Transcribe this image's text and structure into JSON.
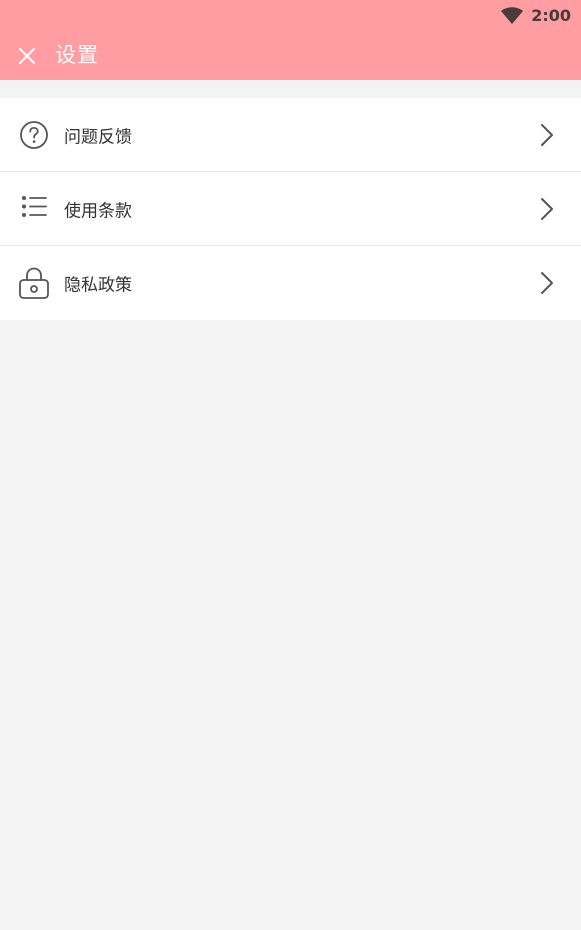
{
  "status_bar": {
    "time": "2:00",
    "wifi_icon": "wifi-icon"
  },
  "app_bar": {
    "close_icon": "close-icon",
    "title": "设置",
    "background_color": "#ff9da2"
  },
  "settings": {
    "items": [
      {
        "label": "问题反馈",
        "icon": "help-circle-icon",
        "chevron": "chevron-right-icon"
      },
      {
        "label": "使用条款",
        "icon": "list-icon",
        "chevron": "chevron-right-icon"
      },
      {
        "label": "隐私政策",
        "icon": "lock-icon",
        "chevron": "chevron-right-icon"
      }
    ]
  }
}
